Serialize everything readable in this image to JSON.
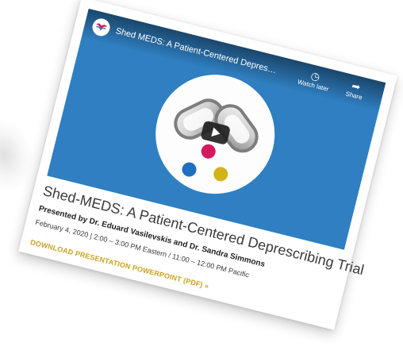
{
  "video": {
    "title": "Shed MEDS: A Patient-Centered Deprescribing T...",
    "watch_later_label": "Watch later",
    "share_label": "Share",
    "icons": {
      "avatar": "channel-logo-icon",
      "watch_later": "clock-icon",
      "share": "share-arrow-icon",
      "play": "play-icon"
    },
    "colors": {
      "background": "#2f7fc2",
      "dot_red": "#d6185e",
      "dot_blue": "#1f6fc0",
      "dot_yellow": "#d3b21c"
    }
  },
  "talk": {
    "title": "Shed-MEDS: A Patient-Centered Deprescribing Trial",
    "presenters": "Presented by Dr. Eduard Vasilevskis and Dr. Sandra Simmons",
    "schedule": "February 4, 2020  |  2:00 – 3:00 PM Eastern / 11:00 – 12:00 PM Pacific",
    "download_label": "DOWNLOAD PRESENTATION POWERPOINT (PDF) »",
    "link_color": "#c9a21c"
  }
}
